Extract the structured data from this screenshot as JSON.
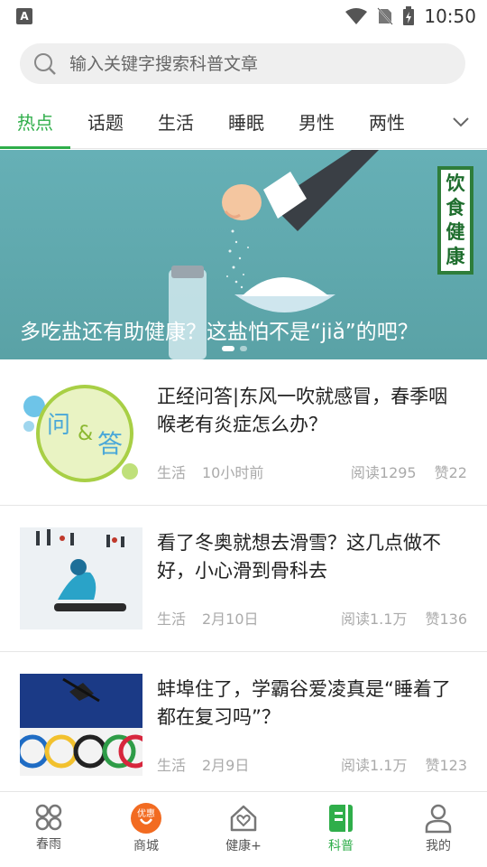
{
  "status": {
    "carrier_icon": "A",
    "time": "10:50"
  },
  "search": {
    "placeholder": "输入关键字搜索科普文章"
  },
  "tabs": [
    {
      "label": "热点"
    },
    {
      "label": "话题"
    },
    {
      "label": "生活"
    },
    {
      "label": "睡眠"
    },
    {
      "label": "男性"
    },
    {
      "label": "两性"
    }
  ],
  "banner": {
    "title": "多吃盐还有助健康？这盐怕不是“jiǎ”的吧？",
    "sign_text": "饮食健康"
  },
  "articles": [
    {
      "title": "正经问答|东风一吹就感冒，春季咽喉老有炎症怎么办？",
      "category": "生活",
      "time": "10小时前",
      "reads": "阅读1295",
      "likes": "赞22",
      "thumb_text_1": "问",
      "thumb_text_2": "&",
      "thumb_text_3": "答"
    },
    {
      "title": "看了冬奥就想去滑雪？这几点做不好，小心滑到骨科去",
      "category": "生活",
      "time": "2月10日",
      "reads": "阅读1.1万",
      "likes": "赞136"
    },
    {
      "title": "蚌埠住了，学霸谷爱凌真是“睡着了都在复习吗”？",
      "category": "生活",
      "time": "2月9日",
      "reads": "阅读1.1万",
      "likes": "赞123"
    }
  ],
  "nav": [
    {
      "label": "春雨",
      "icon": "grid-icon"
    },
    {
      "label": "商城",
      "icon": "shop-icon",
      "badge": "优惠"
    },
    {
      "label": "健康+",
      "icon": "home-heart-icon"
    },
    {
      "label": "科普",
      "icon": "book-icon"
    },
    {
      "label": "我的",
      "icon": "user-icon"
    }
  ],
  "colors": {
    "accent": "#2fae4a",
    "shop": "#f26b21",
    "banner_bg": "#62aab0"
  }
}
